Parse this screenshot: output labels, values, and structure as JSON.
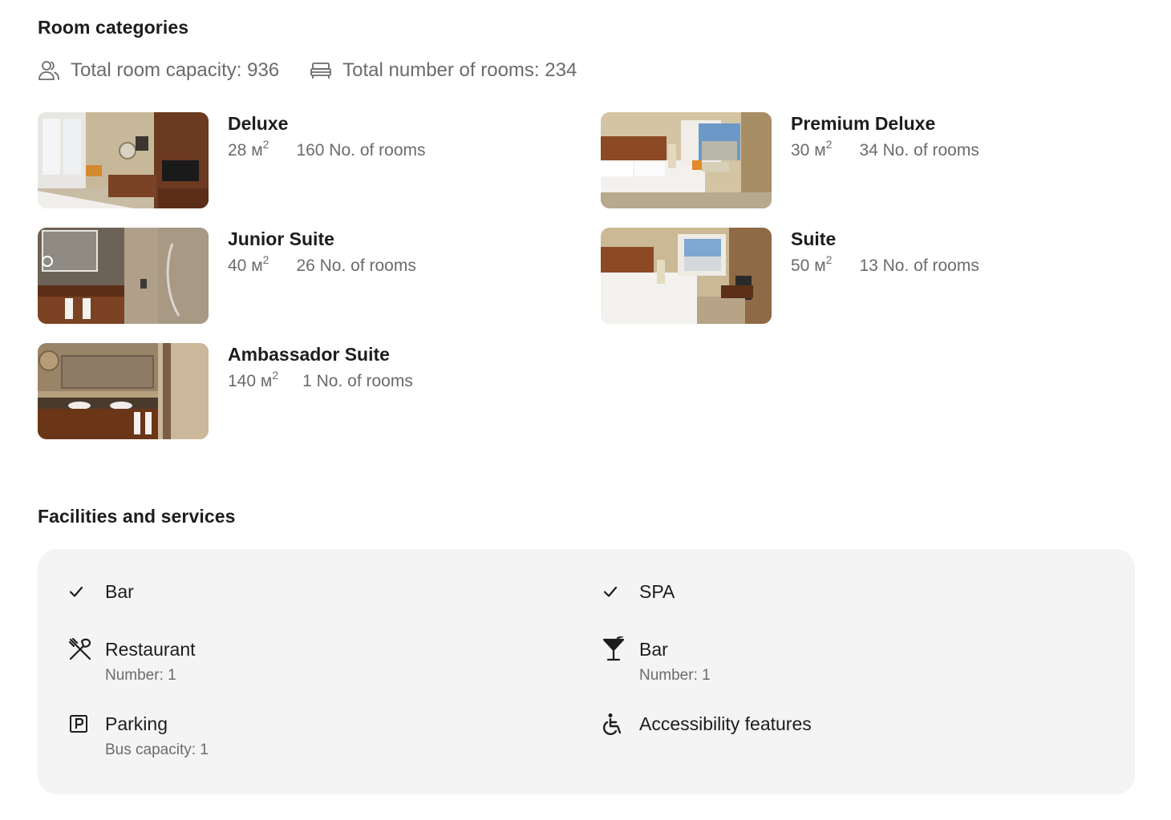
{
  "rooms_section": {
    "title": "Room categories",
    "total_capacity": "Total room capacity: 936",
    "total_rooms": "Total number of rooms: 234",
    "rooms": [
      {
        "name": "Deluxe",
        "area": "28 м",
        "area_unit_exp": "2",
        "count": "160 No. of rooms"
      },
      {
        "name": "Premium Deluxe",
        "area": "30 м",
        "area_unit_exp": "2",
        "count": "34 No. of rooms"
      },
      {
        "name": "Junior Suite",
        "area": "40 м",
        "area_unit_exp": "2",
        "count": "26 No. of rooms"
      },
      {
        "name": "Suite",
        "area": "50 м",
        "area_unit_exp": "2",
        "count": "13 No. of rooms"
      },
      {
        "name": "Ambassador Suite",
        "area": "140 м",
        "area_unit_exp": "2",
        "count": "1 No. of rooms"
      }
    ]
  },
  "facilities_section": {
    "title": "Facilities and services",
    "items": [
      {
        "label": "Bar",
        "icon": "check-icon"
      },
      {
        "label": "SPA",
        "icon": "check-icon"
      },
      {
        "label": "Restaurant",
        "sub": "Number: 1",
        "icon": "cutlery-icon"
      },
      {
        "label": "Bar",
        "sub": "Number: 1",
        "icon": "cocktail-icon"
      },
      {
        "label": "Parking",
        "sub": "Bus capacity: 1",
        "icon": "parking-icon"
      },
      {
        "label": "Accessibility features",
        "icon": "wheelchair-icon"
      }
    ]
  }
}
